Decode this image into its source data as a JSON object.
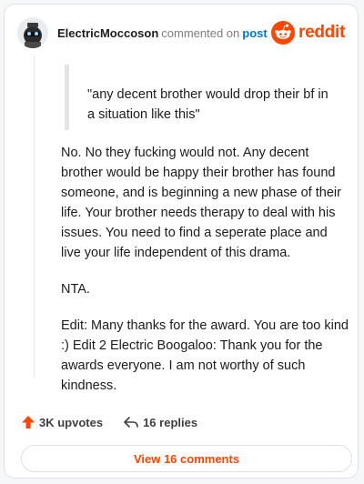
{
  "header": {
    "username": "ElectricMoccoson",
    "action_text": "commented on",
    "post_link": "post",
    "brand": "reddit"
  },
  "comment": {
    "quote": "\"any decent brother would drop their bf in a situation like this\"",
    "paragraphs": [
      "No. No they fucking would not. Any decent brother would be happy their brother has found someone, and is beginning a new phase of their life. Your brother needs therapy to deal with his issues. You need to find a seperate place and live your life independent of this drama.",
      "NTA.",
      "Edit: Many thanks for the award. You are too kind :) Edit 2 Electric Boogaloo: Thank you for the awards everyone. I am not worthy of such kindness."
    ]
  },
  "footer": {
    "upvotes": "3K upvotes",
    "replies": "16 replies",
    "view_comments": "View 16 comments"
  },
  "colors": {
    "accent": "#ff4500",
    "link": "#0079d3"
  },
  "icons": [
    "avatar-image",
    "reddit-logo-icon",
    "upvote-arrow-icon",
    "reply-arrow-icon"
  ]
}
